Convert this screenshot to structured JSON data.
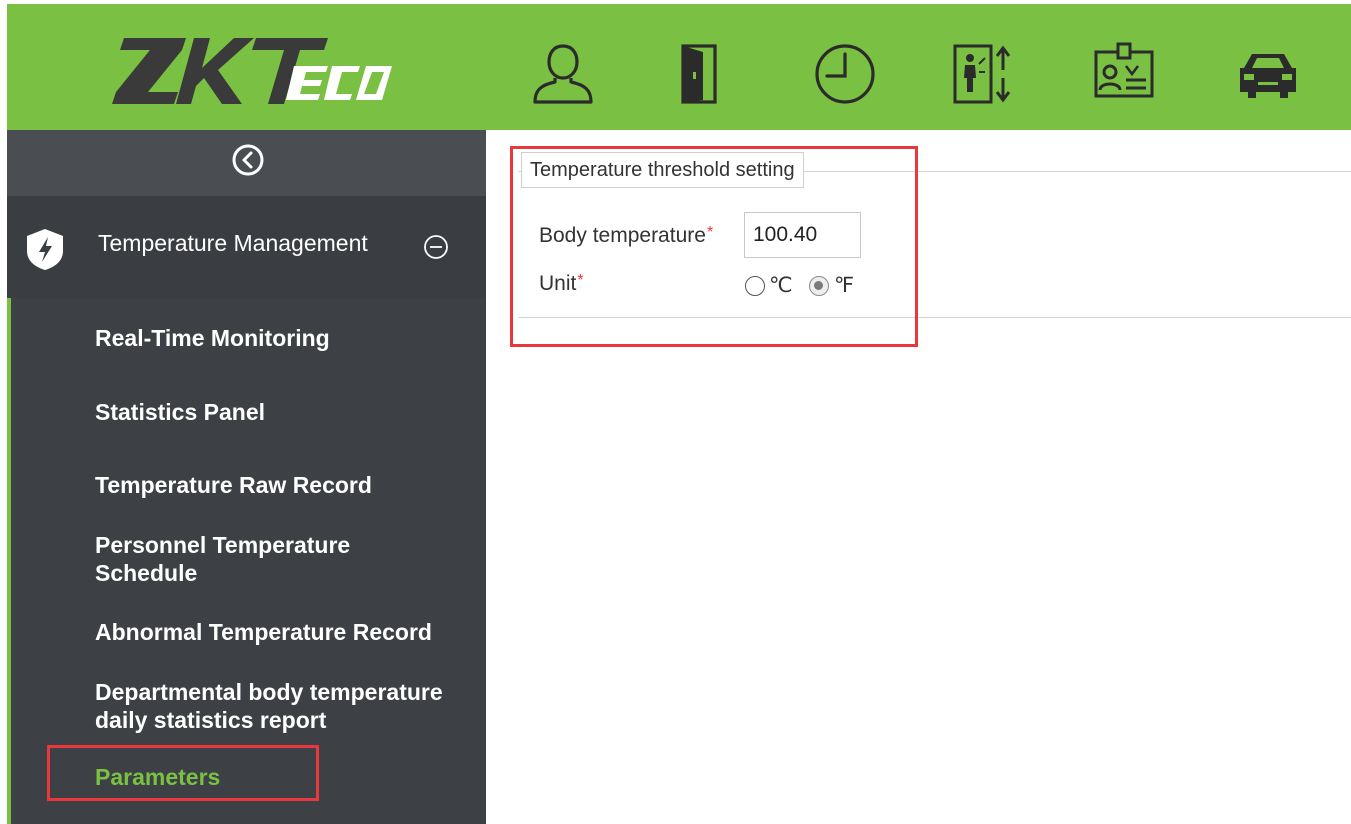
{
  "header": {
    "logo_text": "ZKTeco",
    "bg_color": "#7ac143",
    "modules": [
      {
        "icon": "person-icon"
      },
      {
        "icon": "door-icon"
      },
      {
        "icon": "clock-icon"
      },
      {
        "icon": "elevator-icon"
      },
      {
        "icon": "visitor-badge-icon"
      },
      {
        "icon": "car-icon"
      }
    ]
  },
  "sidebar": {
    "collapse_icon": "chevron-left-circle-icon",
    "module": {
      "title": "Temperature Management",
      "icon": "shield-lightning-icon",
      "toggle_icon": "minus-circle-icon"
    },
    "items": [
      {
        "label": "Real-Time Monitoring"
      },
      {
        "label": "Statistics Panel"
      },
      {
        "label": "Temperature Raw Record"
      },
      {
        "label": "Personnel Temperature Schedule"
      },
      {
        "label": "Abnormal Temperature Record"
      },
      {
        "label": "Departmental body temperature daily statistics report"
      },
      {
        "label": "Parameters",
        "active": true
      }
    ],
    "active_color": "#7ac143"
  },
  "content": {
    "fieldset_title": "Temperature threshold setting",
    "body_temperature": {
      "label": "Body temperature",
      "required_mark": "*",
      "value": "100.40"
    },
    "unit": {
      "label": "Unit",
      "required_mark": "*",
      "options": [
        {
          "label": "℃",
          "checked": false
        },
        {
          "label": "℉",
          "checked": true
        }
      ]
    },
    "highlight_color": "#e8373d"
  }
}
